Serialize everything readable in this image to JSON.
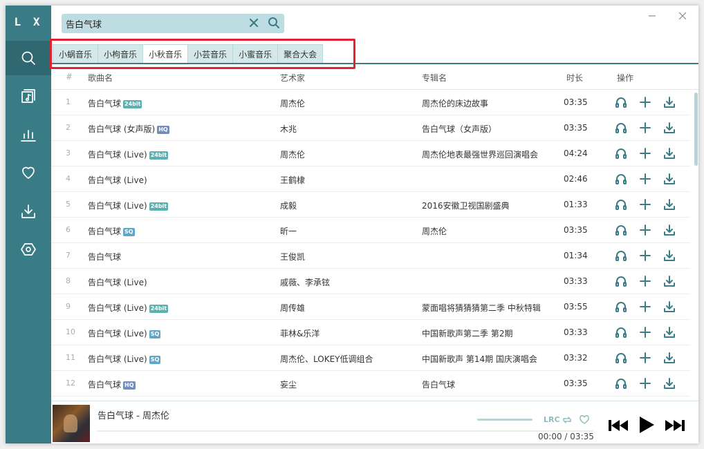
{
  "app": {
    "logo": "L X"
  },
  "search": {
    "value": "告白气球"
  },
  "tabs": [
    {
      "label": "小蜗音乐",
      "active": false
    },
    {
      "label": "小枸音乐",
      "active": false
    },
    {
      "label": "小秋音乐",
      "active": true
    },
    {
      "label": "小芸音乐",
      "active": false
    },
    {
      "label": "小蜜音乐",
      "active": false
    },
    {
      "label": "聚合大会",
      "active": false
    }
  ],
  "table": {
    "headers": {
      "num": "#",
      "name": "歌曲名",
      "artist": "艺术家",
      "album": "专辑名",
      "duration": "时长",
      "ops": "操作"
    },
    "rows": [
      {
        "num": "1",
        "name": "告白气球",
        "badge": "24bit",
        "artist": "周杰伦",
        "album": "周杰伦的床边故事",
        "duration": "03:35"
      },
      {
        "num": "2",
        "name": "告白气球 (女声版)",
        "badge": "HQ",
        "artist": "木兆",
        "album": "告白气球（女声版）",
        "duration": "03:35"
      },
      {
        "num": "3",
        "name": "告白气球 (Live)",
        "badge": "24bit",
        "artist": "周杰伦",
        "album": "周杰伦地表最强世界巡回演唱会",
        "duration": "04:24"
      },
      {
        "num": "4",
        "name": "告白气球 (Live)",
        "badge": "",
        "artist": "王鹤棣",
        "album": "",
        "duration": "02:46"
      },
      {
        "num": "5",
        "name": "告白气球 (Live)",
        "badge": "24bit",
        "artist": "成毅",
        "album": "2016安徽卫视国剧盛典",
        "duration": "01:33"
      },
      {
        "num": "6",
        "name": "告白气球",
        "badge": "SQ",
        "artist": "昕一",
        "album": "周杰伦",
        "duration": "03:35"
      },
      {
        "num": "7",
        "name": "告白气球",
        "badge": "",
        "artist": "王俊凯",
        "album": "",
        "duration": "01:34"
      },
      {
        "num": "8",
        "name": "告白气球 (Live)",
        "badge": "",
        "artist": "戚薇、李承铉",
        "album": "",
        "duration": "03:33"
      },
      {
        "num": "9",
        "name": "告白气球 (Live)",
        "badge": "24bit",
        "artist": "周传雄",
        "album": "蒙面唱将猜猜猜第二季 中秋特辑",
        "duration": "03:55"
      },
      {
        "num": "10",
        "name": "告白气球 (Live)",
        "badge": "SQ",
        "artist": "菲林&乐洋",
        "album": "中国新歌声第二季 第2期",
        "duration": "03:33"
      },
      {
        "num": "11",
        "name": "告白气球 (Live)",
        "badge": "SQ",
        "artist": "周杰伦、LOKEY低调组合",
        "album": "中国新歌声 第14期 国庆演唱会",
        "duration": "03:32"
      },
      {
        "num": "12",
        "name": "告白气球",
        "badge": "HQ",
        "artist": "妄尘",
        "album": "告白气球",
        "duration": "03:35"
      }
    ]
  },
  "player": {
    "title": "告白气球 - 周杰伦",
    "current_time": "00:00",
    "separator": "/",
    "total_time": "03:35",
    "progress": 0,
    "lrc_label": "LRC"
  },
  "icons": {
    "nav": [
      "search-icon",
      "song-list-icon",
      "leaderboard-icon",
      "heart-icon",
      "download-icon",
      "settings-icon"
    ],
    "row_ops": [
      "headphones-icon",
      "plus-icon",
      "download-icon"
    ]
  },
  "colors": {
    "accent": "#3a7c86",
    "sidebar_active": "#2f6870",
    "tab_bg": "#d4e8ea",
    "highlight": "#e3212f"
  }
}
